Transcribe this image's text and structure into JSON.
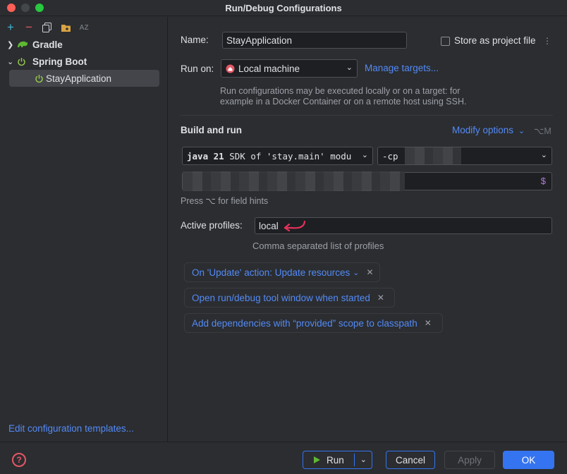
{
  "window": {
    "title": "Run/Debug Configurations"
  },
  "toolbar": {
    "add_icon": "plus-icon",
    "remove_icon": "minus-icon",
    "copy_icon": "copy-icon",
    "folder_icon": "new-folder-icon",
    "sort_label": "AZ"
  },
  "tree": {
    "gradle": {
      "label": "Gradle"
    },
    "spring_boot": {
      "label": "Spring Boot"
    },
    "stay_application": {
      "label": "StayApplication"
    }
  },
  "edit_templates_link": "Edit configuration templates...",
  "form": {
    "name_label": "Name:",
    "name_value": "StayApplication",
    "store_label": "Store as project file",
    "run_on_label": "Run on:",
    "run_on_value": "Local machine",
    "manage_targets": "Manage targets...",
    "run_on_hint_1": "Run configurations may be executed locally or on a target: for",
    "run_on_hint_2": "example in a Docker Container or on a remote host using SSH.",
    "build_and_run": "Build and run",
    "modify_options": "Modify options",
    "modify_shortcut": "⌥M",
    "jdk_bold": "java 21",
    "jdk_rest": " SDK of 'stay.main' modu",
    "classpath_prefix": "-cp",
    "field_hints": "Press ⌥ for field hints",
    "active_profiles_label": "Active profiles:",
    "active_profiles_value": "local",
    "profiles_hint": "Comma separated list of profiles"
  },
  "chips": [
    {
      "label": "On 'Update' action: Update resources",
      "has_dropdown": true
    },
    {
      "label": "Open run/debug tool window when started",
      "has_dropdown": false
    },
    {
      "label": "Add dependencies with “provided” scope to classpath",
      "has_dropdown": false
    }
  ],
  "buttons": {
    "help": "?",
    "run": "Run",
    "cancel": "Cancel",
    "apply": "Apply",
    "ok": "OK"
  },
  "colors": {
    "accent": "#3574f0",
    "link": "#548af7",
    "annotation": "#e5315a"
  }
}
